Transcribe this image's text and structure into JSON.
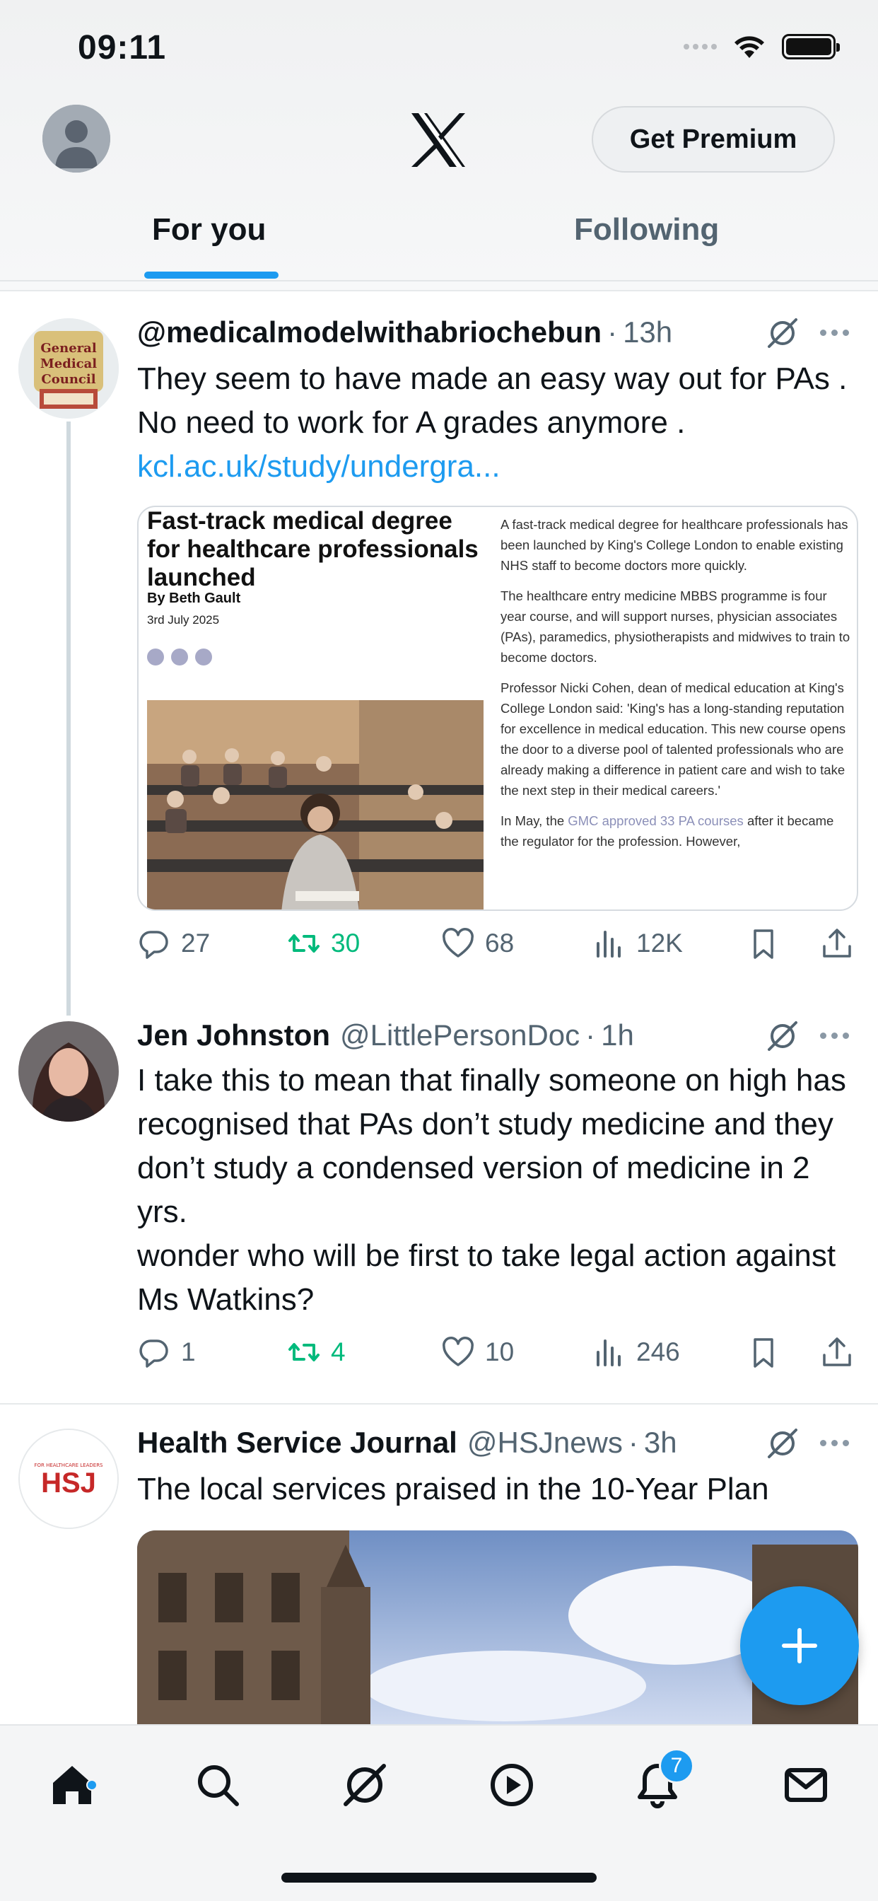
{
  "status_bar": {
    "time": "09:11"
  },
  "header": {
    "premium_label": "Get Premium"
  },
  "tabs": [
    {
      "label": "For you",
      "active": true
    },
    {
      "label": "Following",
      "active": false
    }
  ],
  "tweets": [
    {
      "name": "",
      "handle": "@medicalmodelwithabriochebun",
      "time": "13h",
      "avatar_lettering": "General Medical Council",
      "text": "They seem to have made an easy way out for PAs . No need to work for A grades anymore .",
      "link": "kcl.ac.uk/study/undergra...",
      "card": {
        "title": "Fast-track medical degree for healthcare professionals launched",
        "byline": "By Beth Gault",
        "date": "3rd July 2025",
        "p1": "A fast-track medical degree for healthcare professionals has been launched by King's College London to enable existing NHS staff to become doctors more quickly.",
        "p2": "The healthcare entry medicine MBBS programme is four year course, and will support nurses, physician associates (PAs), paramedics, physiotherapists and midwives to train to become doctors.",
        "p3": "Professor Nicki Cohen, dean of medical education at King's College London said: 'King's has a long-standing reputation for excellence in medical education. This new course opens the door to a diverse pool of talented professionals who are already making a difference in patient care and wish to take the next step in their medical careers.'",
        "p4_a": "In May, the ",
        "p4_link": "GMC approved 33 PA courses",
        "p4_b": " after it became the regulator for the profession. However,"
      },
      "stats": {
        "replies": "27",
        "reposts": "30",
        "likes": "68",
        "views": "12K"
      }
    },
    {
      "name": "Jen Johnston",
      "handle": "@LittlePersonDoc",
      "time": "1h",
      "text": "I take this to mean that finally someone on high has recognised that PAs don’t study medicine and they don’t study a condensed version of medicine in 2 yrs.\nwonder who will be first to take legal action against Ms Watkins?",
      "stats": {
        "replies": "1",
        "reposts": "4",
        "likes": "10",
        "views": "246"
      }
    },
    {
      "name": "Health Service Journal",
      "handle": "@HSJnews",
      "time": "3h",
      "avatar_lettering": "HSJ",
      "avatar_tagline": "FOR HEALTHCARE LEADERS",
      "text": "The local services praised in the 10-Year Plan"
    }
  ],
  "bottom_nav": {
    "items": [
      "home-icon",
      "search-icon",
      "grok-icon",
      "video-icon",
      "notifications-icon",
      "messages-icon"
    ],
    "notifications_badge": "7"
  },
  "colors": {
    "accent": "#1d9bf0",
    "repost": "#00ba7c",
    "secondary_text": "#536471"
  }
}
